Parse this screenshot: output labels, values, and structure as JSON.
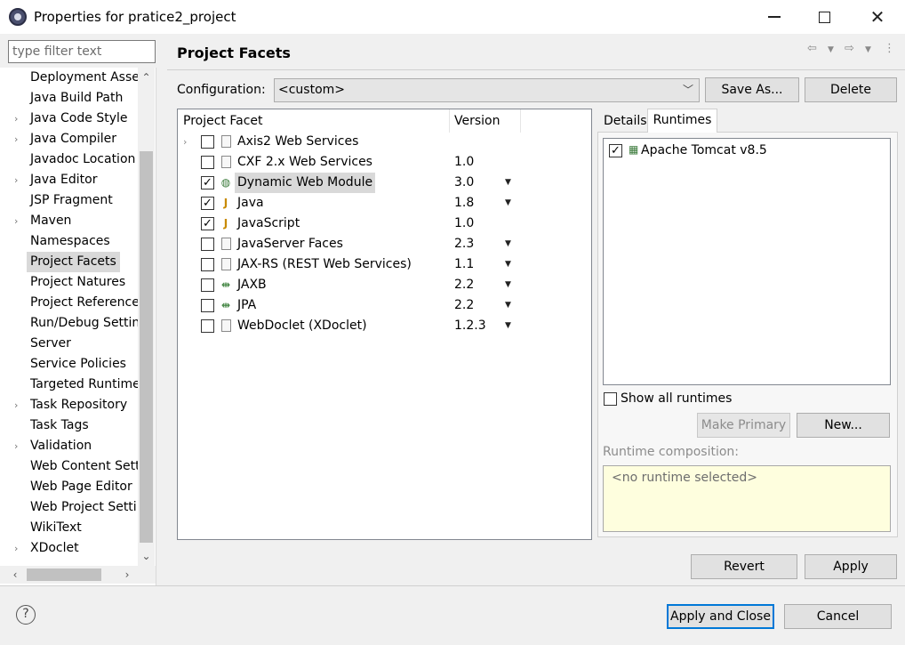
{
  "window": {
    "title": "Properties for pratice2_project"
  },
  "filter": {
    "placeholder": "type filter text"
  },
  "sidebar": {
    "items": [
      {
        "label": "Deployment Assembly",
        "expandable": false
      },
      {
        "label": "Java Build Path",
        "expandable": false
      },
      {
        "label": "Java Code Style",
        "expandable": true
      },
      {
        "label": "Java Compiler",
        "expandable": true
      },
      {
        "label": "Javadoc Location",
        "expandable": false
      },
      {
        "label": "Java Editor",
        "expandable": true
      },
      {
        "label": "JSP Fragment",
        "expandable": false
      },
      {
        "label": "Maven",
        "expandable": true
      },
      {
        "label": "Namespaces",
        "expandable": false
      },
      {
        "label": "Project Facets",
        "expandable": false,
        "selected": true
      },
      {
        "label": "Project Natures",
        "expandable": false
      },
      {
        "label": "Project References",
        "expandable": false
      },
      {
        "label": "Run/Debug Settings",
        "expandable": false
      },
      {
        "label": "Server",
        "expandable": false
      },
      {
        "label": "Service Policies",
        "expandable": false
      },
      {
        "label": "Targeted Runtimes",
        "expandable": false
      },
      {
        "label": "Task Repository",
        "expandable": true
      },
      {
        "label": "Task Tags",
        "expandable": false
      },
      {
        "label": "Validation",
        "expandable": true
      },
      {
        "label": "Web Content Settings",
        "expandable": false
      },
      {
        "label": "Web Page Editor",
        "expandable": false
      },
      {
        "label": "Web Project Settings",
        "expandable": false
      },
      {
        "label": "WikiText",
        "expandable": false
      },
      {
        "label": "XDoclet",
        "expandable": true
      }
    ]
  },
  "header": {
    "title": "Project Facets"
  },
  "configuration": {
    "label": "Configuration:",
    "value": "<custom>",
    "save_as": "Save As...",
    "delete": "Delete"
  },
  "facets": {
    "col_facet": "Project Facet",
    "col_version": "Version",
    "rows": [
      {
        "name": "Axis2 Web Services",
        "version": "",
        "checked": false,
        "icon": "document-icon",
        "expandable": true,
        "dropdown": false
      },
      {
        "name": "CXF 2.x Web Services",
        "version": "1.0",
        "checked": false,
        "icon": "document-icon",
        "expandable": false,
        "dropdown": false
      },
      {
        "name": "Dynamic Web Module",
        "version": "3.0",
        "checked": true,
        "icon": "web-module-icon",
        "expandable": false,
        "dropdown": true,
        "selected": true
      },
      {
        "name": "Java",
        "version": "1.8",
        "checked": true,
        "icon": "jar-icon",
        "expandable": false,
        "dropdown": true
      },
      {
        "name": "JavaScript",
        "version": "1.0",
        "checked": true,
        "icon": "jar-icon",
        "expandable": false,
        "dropdown": false
      },
      {
        "name": "JavaServer Faces",
        "version": "2.3",
        "checked": false,
        "icon": "document-icon",
        "expandable": false,
        "dropdown": true
      },
      {
        "name": "JAX-RS (REST Web Services)",
        "version": "1.1",
        "checked": false,
        "icon": "document-icon",
        "expandable": false,
        "dropdown": true
      },
      {
        "name": "JAXB",
        "version": "2.2",
        "checked": false,
        "icon": "arrows-icon",
        "expandable": false,
        "dropdown": true
      },
      {
        "name": "JPA",
        "version": "2.2",
        "checked": false,
        "icon": "arrows-icon",
        "expandable": false,
        "dropdown": true
      },
      {
        "name": "WebDoclet (XDoclet)",
        "version": "1.2.3",
        "checked": false,
        "icon": "document-icon",
        "expandable": false,
        "dropdown": true
      }
    ]
  },
  "tabs": {
    "details": "Details",
    "runtimes": "Runtimes"
  },
  "runtimes": {
    "items": [
      {
        "name": "Apache Tomcat v8.5",
        "checked": true
      }
    ],
    "show_all_label": "Show all runtimes",
    "make_primary": "Make Primary",
    "new": "New...",
    "composition_label": "Runtime composition:",
    "composition_value": "<no runtime selected>"
  },
  "actions": {
    "revert": "Revert",
    "apply": "Apply",
    "apply_close": "Apply and Close",
    "cancel": "Cancel"
  },
  "colors": {
    "accent": "#0078d7",
    "selection": "#d9d9d9",
    "composition_bg": "#fefede"
  }
}
